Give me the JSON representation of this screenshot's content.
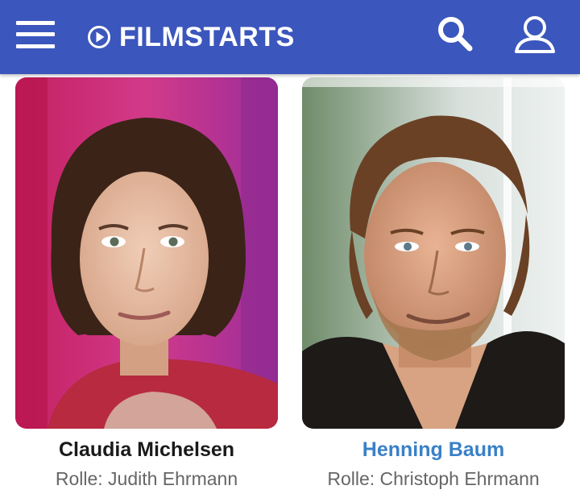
{
  "header": {
    "brand": "FILMSTARTS",
    "bg_color": "#3b56bc",
    "menu_icon": "hamburger-menu-icon",
    "brand_icon": "play-circle-icon",
    "search_icon": "search-icon",
    "account_icon": "user-icon"
  },
  "cast": [
    {
      "name": "Claudia Michelsen",
      "role": "Rolle: Judith Ehrmann",
      "linked": false
    },
    {
      "name": "Henning Baum",
      "role": "Rolle: Christoph Ehrmann",
      "linked": true,
      "link_color": "#3a80c7"
    }
  ]
}
